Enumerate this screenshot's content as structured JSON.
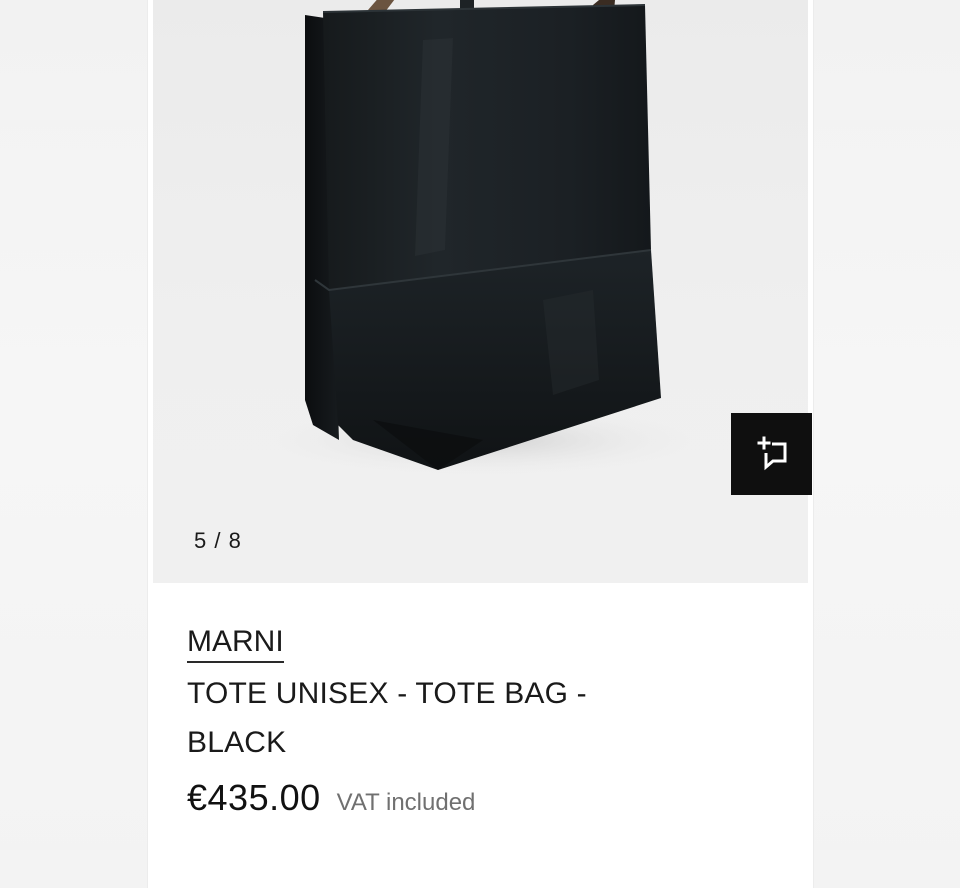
{
  "gallery": {
    "counter_current": "5",
    "counter_separator": "/",
    "counter_total": "8",
    "product_image": "black-tote-bag-photo",
    "similar_icon": "sparkle-crop-icon"
  },
  "product": {
    "brand": "MARNI",
    "name": "TOTE UNISEX - TOTE BAG - BLACK",
    "price": "€435.00",
    "vat_note": "VAT included"
  },
  "colors": {
    "button_bg": "#0f0f0f",
    "text_primary": "#1a1a1a",
    "text_muted": "#707070"
  }
}
